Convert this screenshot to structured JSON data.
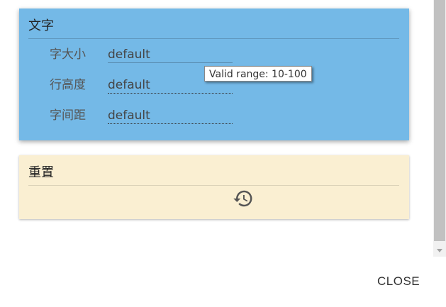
{
  "text_card": {
    "title": "文字",
    "rows": [
      {
        "label": "字大小",
        "value": "default"
      },
      {
        "label": "行高度",
        "value": "default"
      },
      {
        "label": "字间距",
        "value": "default"
      }
    ],
    "tooltip": "Valid range: 10-100"
  },
  "reset_card": {
    "title": "重置",
    "icon": "history-icon"
  },
  "footer": {
    "close_label": "CLOSE"
  },
  "colors": {
    "text_card_bg": "#74b9e7",
    "reset_card_bg": "#faefd2"
  }
}
